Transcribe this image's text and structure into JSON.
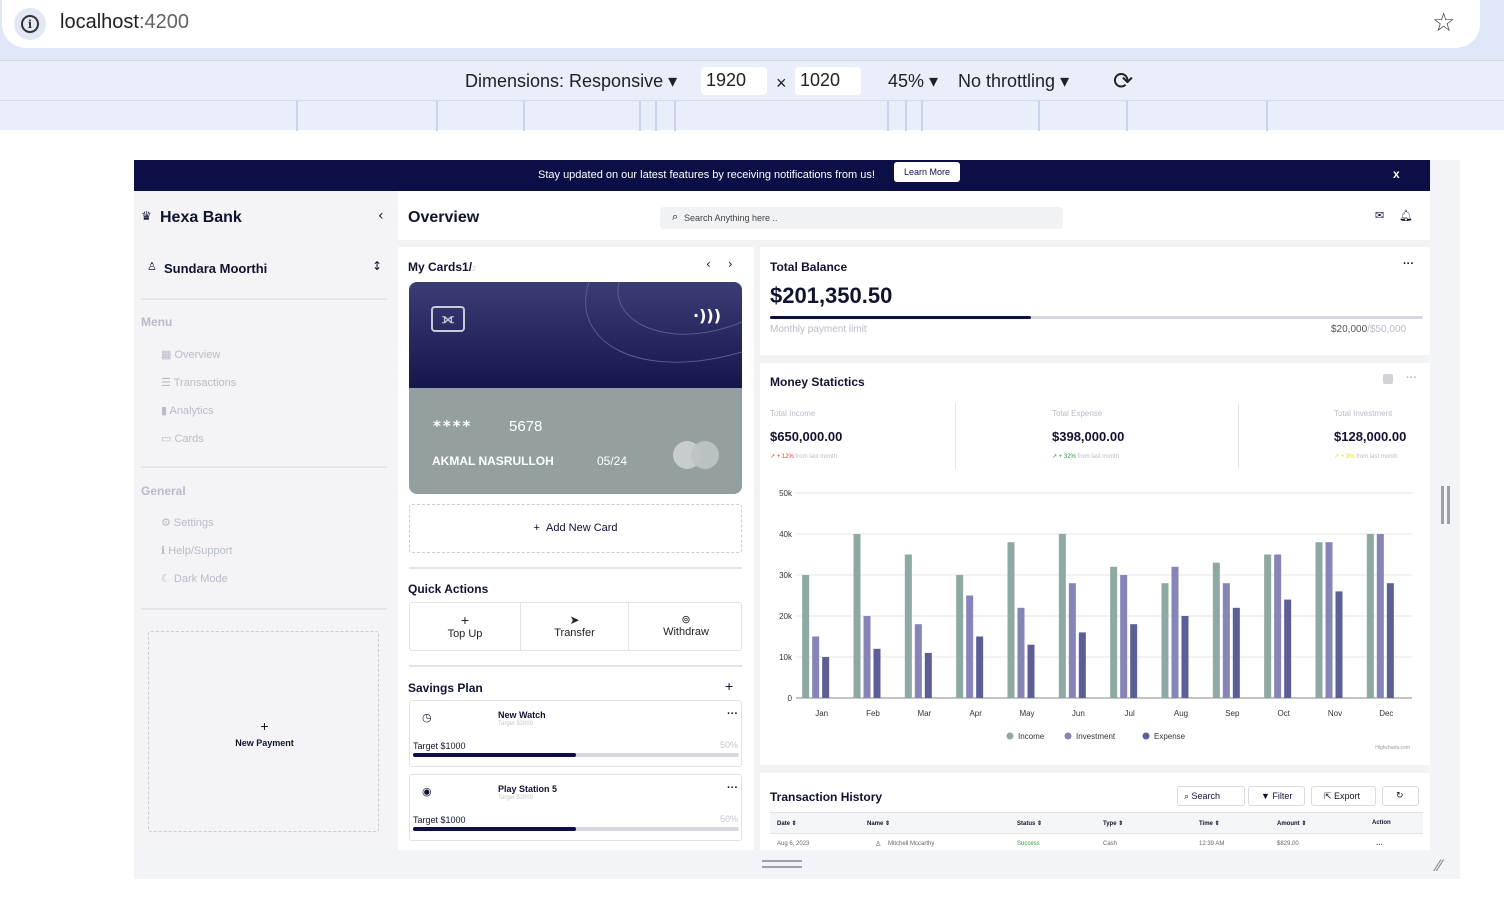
{
  "browser": {
    "url_host": "localhost",
    "url_port": ":4200",
    "devtools": {
      "dimensions_label": "Dimensions: Responsive",
      "width": "1920",
      "times": "×",
      "height": "1020",
      "zoom": "45%",
      "throttling": "No throttling"
    }
  },
  "banner": {
    "text": "Stay updated on our latest features by receiving notifications from us!",
    "button": "Learn More",
    "close": "x"
  },
  "sidebar": {
    "brand": "Hexa Bank",
    "user": "Sundara Moorthi",
    "menu_title": "Menu",
    "menu_items": [
      "Overview",
      "Transactions",
      "Analytics",
      "Cards"
    ],
    "general_title": "General",
    "general_items": [
      "Settings",
      "Help/Support",
      "Dark Mode"
    ],
    "new_payment": "New Payment"
  },
  "header": {
    "title": "Overview",
    "search_placeholder": "Search Anything here .."
  },
  "cards": {
    "title": "My Cards1/",
    "title_total": "2",
    "card_number": "5678",
    "card_stars": "****",
    "card_holder": "AKMAL NASRULLOH",
    "card_expiry": "05/24",
    "add_card": "Add New Card"
  },
  "quick_actions": {
    "title": "Quick Actions",
    "items": [
      "Top Up",
      "Transfer",
      "Withdraw"
    ]
  },
  "savings": {
    "title": "Savings Plan",
    "plans": [
      {
        "name": "New Watch",
        "target_small": "Target $2000",
        "target": "Target $1000",
        "percent": "50%",
        "progress": 0.5
      },
      {
        "name": "Play Station 5",
        "target_small": "Target $2000",
        "target": "Target $1000",
        "percent": "50%",
        "progress": 0.5
      }
    ]
  },
  "balance": {
    "title": "Total Balance",
    "amount": "$201,350.50",
    "limit_label": "Monthly payment limit",
    "limit_used": "$20,000",
    "limit_total": "/$50,000",
    "progress": 0.4
  },
  "stats": {
    "title": "Money Statictics",
    "income_label": "Total Income",
    "income": "$650,000.00",
    "income_change": "+ 12%",
    "expense_label": "Total Expense",
    "expense": "$398,000.00",
    "expense_change": "+ 32%",
    "investment_label": "Total Investment",
    "investment": "$128,000.00",
    "investment_change": "+ 3%",
    "from_last": "from last month",
    "credits": "Highcharts.com"
  },
  "chart_data": {
    "type": "bar",
    "categories": [
      "Jan",
      "Feb",
      "Mar",
      "Apr",
      "May",
      "Jun",
      "Jul",
      "Aug",
      "Sep",
      "Oct",
      "Nov",
      "Dec"
    ],
    "series": [
      {
        "name": "Income",
        "color": "#8ea8a3",
        "values": [
          30000,
          40000,
          35000,
          30000,
          38000,
          40000,
          32000,
          28000,
          33000,
          35000,
          38000,
          40000
        ]
      },
      {
        "name": "Investment",
        "color": "#8785b8",
        "values": [
          15000,
          20000,
          18000,
          25000,
          22000,
          28000,
          30000,
          32000,
          28000,
          35000,
          38000,
          40000
        ]
      },
      {
        "name": "Expense",
        "color": "#5b5f96",
        "values": [
          10000,
          12000,
          11000,
          15000,
          13000,
          16000,
          18000,
          20000,
          22000,
          24000,
          26000,
          28000
        ]
      }
    ],
    "yticks": [
      "0",
      "10k",
      "20k",
      "30k",
      "40k",
      "50k"
    ],
    "ylim": [
      0,
      50000
    ],
    "grid": true,
    "legend": "bottom-center"
  },
  "transactions": {
    "title": "Transaction History",
    "search": "Search",
    "filter": "Filter",
    "export": "Export",
    "columns": [
      "Date",
      "Name",
      "Status",
      "Type",
      "Time",
      "Amount",
      "Action"
    ],
    "rows": [
      {
        "date": "Aug 6, 2023",
        "name": "Mitchell Mccarthy",
        "status": "Success",
        "type": "Cash",
        "time": "12:39 AM",
        "amount": "$829.00",
        "action": "..."
      }
    ]
  }
}
